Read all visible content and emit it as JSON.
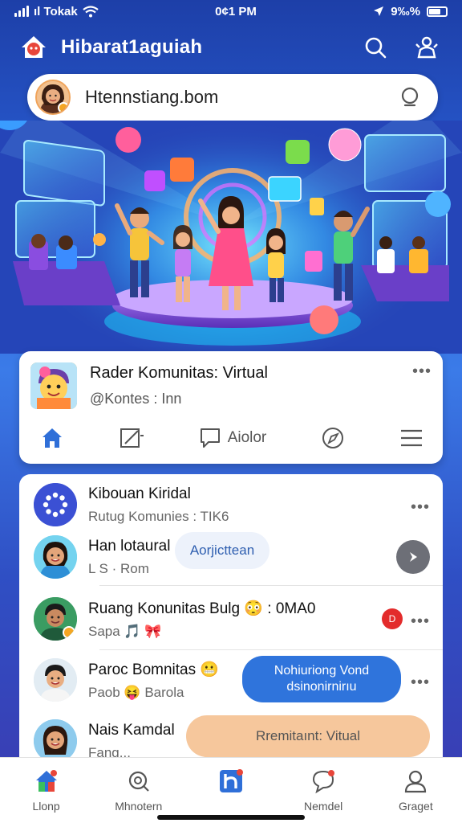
{
  "status": {
    "carrier": "ıl Tokak",
    "time": "0¢1 PM",
    "battery": "9‰%"
  },
  "header": {
    "title": "Hibarat1aguiah"
  },
  "search": {
    "text": "Htennstiang.bom"
  },
  "community_card": {
    "title": "Rader Komunitas: Virtual",
    "handle": "@Kontes : Inn",
    "more": "•••",
    "tabs": [
      {
        "icon": "home-icon",
        "label": ""
      },
      {
        "icon": "edit-icon",
        "label": ""
      },
      {
        "icon": "chat-icon",
        "label": "Aiolor"
      },
      {
        "icon": "compass-icon",
        "label": ""
      },
      {
        "icon": "menu-icon",
        "label": ""
      }
    ]
  },
  "list": {
    "items": [
      {
        "title": "Kibouan Kiridal",
        "sub": "Rutug Komunies : TIK6",
        "more": "•••"
      },
      {
        "title": "Han lotaural",
        "sub": "L S · Rom",
        "pill": "Aorjicttean"
      },
      {
        "title": "Ruang Konunitas Bulg 😳 : 0MA0",
        "sub": "Sapa 🎵 🎀",
        "badge": "D",
        "more": "•••"
      },
      {
        "title": "Paroc Bomnitas 😬",
        "sub": "Paob 😝 Barola",
        "pill": "Nohiuriong Vond dsinonirnirıu",
        "more": "•••"
      },
      {
        "title": "Nais Kamdal",
        "sub": "Fang...",
        "pill": "Rremitaınt: Vitual"
      }
    ]
  },
  "bottom_nav": [
    {
      "label": "Llonp",
      "icon": "home-icon"
    },
    {
      "label": "Mhnotern",
      "icon": "search-icon"
    },
    {
      "label": "",
      "icon": "brand-icon"
    },
    {
      "label": "Nemdel",
      "icon": "notification-icon"
    },
    {
      "label": "Graget",
      "icon": "profile-icon"
    }
  ],
  "colors": {
    "accent": "#2f6fd8",
    "pill_blue": "#2f74dc",
    "pill_peach": "#f6c79c",
    "badge_red": "#e32b2b"
  }
}
